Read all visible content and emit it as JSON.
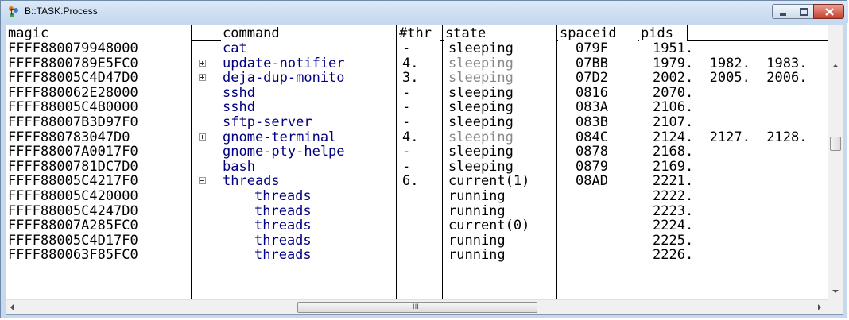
{
  "window": {
    "title": "B::TASK.Process",
    "colors": {
      "title_gradient_top": "#dce9f7",
      "close_button": "#c5402b",
      "command_text": "#000080",
      "dimmed_state": "#888888"
    }
  },
  "columns": {
    "magic": "magic",
    "command": "command",
    "thr": "#thr",
    "state": "state",
    "spaceid": "spaceid",
    "pids": "pids"
  },
  "rows": [
    {
      "magic": "FFFF880079948000",
      "expander": "",
      "command": "cat",
      "child": false,
      "thr": "-",
      "state": "sleeping",
      "dim": false,
      "spaceid": "079F",
      "pids": "1951."
    },
    {
      "magic": "FFFF8800789E5FC0",
      "expander": "plus",
      "command": "update-notifier",
      "child": false,
      "thr": "4.",
      "state": "sleeping",
      "dim": true,
      "spaceid": "07BB",
      "pids": "1979.  1982.  1983."
    },
    {
      "magic": "FFFF88005C4D47D0",
      "expander": "plus",
      "command": "deja-dup-monito",
      "child": false,
      "thr": "3.",
      "state": "sleeping",
      "dim": true,
      "spaceid": "07D2",
      "pids": "2002.  2005.  2006."
    },
    {
      "magic": "FFFF880062E28000",
      "expander": "",
      "command": "sshd",
      "child": false,
      "thr": "-",
      "state": "sleeping",
      "dim": false,
      "spaceid": "0816",
      "pids": "2070."
    },
    {
      "magic": "FFFF88005C4B0000",
      "expander": "",
      "command": "sshd",
      "child": false,
      "thr": "-",
      "state": "sleeping",
      "dim": false,
      "spaceid": "083A",
      "pids": "2106."
    },
    {
      "magic": "FFFF88007B3D97F0",
      "expander": "",
      "command": "sftp-server",
      "child": false,
      "thr": "-",
      "state": "sleeping",
      "dim": false,
      "spaceid": "083B",
      "pids": "2107."
    },
    {
      "magic": "FFFF880783047D0",
      "expander": "plus",
      "command": "gnome-terminal",
      "child": false,
      "thr": "4.",
      "state": "sleeping",
      "dim": true,
      "spaceid": "084C",
      "pids": "2124.  2127.  2128."
    },
    {
      "magic": "FFFF88007A0017F0",
      "expander": "",
      "command": "gnome-pty-helpe",
      "child": false,
      "thr": "-",
      "state": "sleeping",
      "dim": false,
      "spaceid": "0878",
      "pids": "2168."
    },
    {
      "magic": "FFFF8800781DC7D0",
      "expander": "",
      "command": "bash",
      "child": false,
      "thr": "-",
      "state": "sleeping",
      "dim": false,
      "spaceid": "0879",
      "pids": "2169."
    },
    {
      "magic": "FFFF88005C4217F0",
      "expander": "minus",
      "command": "threads",
      "child": false,
      "thr": "6.",
      "state": "current(1)",
      "dim": false,
      "spaceid": "08AD",
      "pids": "2221."
    },
    {
      "magic": "FFFF88005C420000",
      "expander": "",
      "command": "threads",
      "child": true,
      "thr": "",
      "state": "running",
      "dim": false,
      "spaceid": "",
      "pids": "2222."
    },
    {
      "magic": "FFFF88005C4247D0",
      "expander": "",
      "command": "threads",
      "child": true,
      "thr": "",
      "state": "running",
      "dim": false,
      "spaceid": "",
      "pids": "2223."
    },
    {
      "magic": "FFFF88007A285FC0",
      "expander": "",
      "command": "threads",
      "child": true,
      "thr": "",
      "state": "current(0)",
      "dim": false,
      "spaceid": "",
      "pids": "2224."
    },
    {
      "magic": "FFFF88005C4D17F0",
      "expander": "",
      "command": "threads",
      "child": true,
      "thr": "",
      "state": "running",
      "dim": false,
      "spaceid": "",
      "pids": "2225."
    },
    {
      "magic": "FFFF880063F85FC0",
      "expander": "",
      "command": "threads",
      "child": true,
      "thr": "",
      "state": "running",
      "dim": false,
      "spaceid": "",
      "pids": "2226."
    }
  ],
  "scrollbar": {
    "grip": "III"
  }
}
